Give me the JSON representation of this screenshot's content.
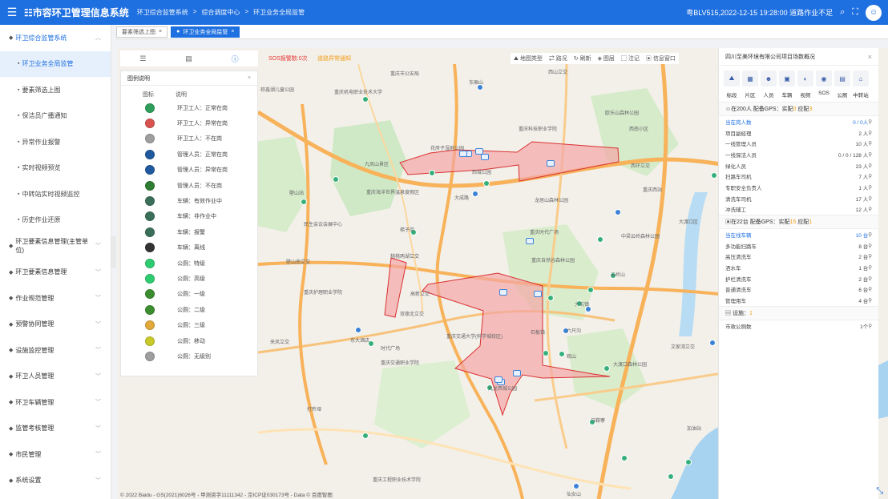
{
  "header": {
    "menu_icon": "menu-icon",
    "logo": "☷市容环卫管理信息系统",
    "crumbs": [
      "环卫综合监管系统",
      ">",
      "综合调度中心",
      ">",
      "环卫业务全局监管"
    ],
    "status": "粤BLV515,2022-12-15 19:28:00 道路作业不足",
    "icons": [
      "search-icon",
      "fullscreen-icon",
      "avatar"
    ]
  },
  "sidebar": {
    "items": [
      {
        "label": "环卫综合监管系统",
        "level": "top",
        "expanded": true
      },
      {
        "label": "环卫业务全局监管",
        "level": "sub",
        "active": true
      },
      {
        "label": "要素筛选上图",
        "level": "sub"
      },
      {
        "label": "保洁员广播通知",
        "level": "sub"
      },
      {
        "label": "异常作业报警",
        "level": "sub"
      },
      {
        "label": "实时视频预览",
        "level": "sub"
      },
      {
        "label": "中转站实时视频监控",
        "level": "sub"
      },
      {
        "label": "历史作业还原",
        "level": "sub"
      },
      {
        "label": "环卫要素信息管理(主管单位)",
        "level": "top"
      },
      {
        "label": "环卫要素信息管理",
        "level": "top"
      },
      {
        "label": "作业规范管理",
        "level": "top"
      },
      {
        "label": "预警协同管理",
        "level": "top"
      },
      {
        "label": "设施监控管理",
        "level": "top"
      },
      {
        "label": "环卫人员管理",
        "level": "top"
      },
      {
        "label": "环卫车辆管理",
        "level": "top"
      },
      {
        "label": "监管考核管理",
        "level": "top"
      },
      {
        "label": "市民管理",
        "level": "top"
      },
      {
        "label": "系统设置",
        "level": "top"
      },
      {
        "label": "设备管理",
        "level": "top"
      }
    ]
  },
  "tabs": [
    {
      "label": "要素筛选上图",
      "active": false
    },
    {
      "label": "环卫业务全局监管",
      "active": true
    }
  ],
  "map": {
    "sos": "SOS报警数:0次",
    "alarm": "道路异常通知",
    "tools": [
      "地图类型",
      "路况",
      "刷新",
      "图层",
      "注记",
      "信息窗口"
    ],
    "legend": {
      "title": "图例说明",
      "col1": "图标",
      "col2": "说明",
      "items": [
        {
          "label": "环卫工人：正常在岗",
          "color": "#2e9e5b"
        },
        {
          "label": "环卫工人：异常在岗",
          "color": "#d9534f"
        },
        {
          "label": "环卫工人：不在岗",
          "color": "#9e9e9e"
        },
        {
          "label": "管理人员：正常在岗",
          "color": "#1f5a9e"
        },
        {
          "label": "管理人员：异常在岗",
          "color": "#1f5a9e"
        },
        {
          "label": "管理人员：不在岗",
          "color": "#2e7d32"
        },
        {
          "label": "车辆：有效作业中",
          "color": "#3a6f5a"
        },
        {
          "label": "车辆：非作业中",
          "color": "#3a6f5a"
        },
        {
          "label": "车辆：报警",
          "color": "#3a6f5a"
        },
        {
          "label": "车辆：离线",
          "color": "#333333"
        },
        {
          "label": "公厕：特级",
          "color": "#2ecc71"
        },
        {
          "label": "公厕：高级",
          "color": "#2ecc71"
        },
        {
          "label": "公厕：一级",
          "color": "#3c8d2f"
        },
        {
          "label": "公厕：二级",
          "color": "#3c8d2f"
        },
        {
          "label": "公厕：三级",
          "color": "#e0a93a"
        },
        {
          "label": "公厕：移动",
          "color": "#c9c92a"
        },
        {
          "label": "公厕：无级别",
          "color": "#9e9e9e"
        }
      ]
    },
    "copyright": "© 2022 Baidu - GS(2021)6026号 - 甲测资字11111342 - 京ICP证030173号 - Data © 百度智图",
    "places": [
      {
        "name": "重庆市公安局",
        "pos": [
          340,
          27
        ]
      },
      {
        "name": "棕鑫湖儿童公园",
        "pos": [
          178,
          47
        ]
      },
      {
        "name": "重庆机电职业技术大学",
        "pos": [
          270,
          50
        ]
      },
      {
        "name": "西山立交",
        "pos": [
          537,
          25
        ]
      },
      {
        "name": "东厢山",
        "pos": [
          438,
          38
        ]
      },
      {
        "name": "欧乐山森林公园",
        "pos": [
          608,
          76
        ]
      },
      {
        "name": "西南小区",
        "pos": [
          638,
          96
        ]
      },
      {
        "name": "重庆科技职业学院",
        "pos": [
          500,
          96
        ]
      },
      {
        "name": "花房子湿地公园",
        "pos": [
          390,
          120
        ]
      },
      {
        "name": "九凤山景区",
        "pos": [
          308,
          140
        ]
      },
      {
        "name": "西城公园",
        "pos": [
          442,
          150
        ]
      },
      {
        "name": "西环立交",
        "pos": [
          640,
          142
        ]
      },
      {
        "name": "重庆海洋世界温泉度假区",
        "pos": [
          310,
          175
        ]
      },
      {
        "name": "大成路",
        "pos": [
          420,
          182
        ]
      },
      {
        "name": "龙居山森林公园",
        "pos": [
          520,
          185
        ]
      },
      {
        "name": "重庆西站",
        "pos": [
          655,
          172
        ]
      },
      {
        "name": "大渡口区",
        "pos": [
          700,
          212
        ]
      },
      {
        "name": "民生会议会展中心",
        "pos": [
          232,
          215
        ]
      },
      {
        "name": "壁山站",
        "pos": [
          214,
          176
        ]
      },
      {
        "name": "梯子岗",
        "pos": [
          352,
          222
        ]
      },
      {
        "name": "重庆时代广场",
        "pos": [
          514,
          225
        ]
      },
      {
        "name": "中梁云岭森林公园",
        "pos": [
          628,
          230
        ]
      },
      {
        "name": "壁山南立交",
        "pos": [
          210,
          262
        ]
      },
      {
        "name": "桃桃两湖立交",
        "pos": [
          340,
          255
        ]
      },
      {
        "name": "重庆自然谷森林公园",
        "pos": [
          516,
          260
        ]
      },
      {
        "name": "云岭山",
        "pos": [
          615,
          278
        ]
      },
      {
        "name": "重庆护理职业学院",
        "pos": [
          232,
          300
        ]
      },
      {
        "name": "高新立交",
        "pos": [
          365,
          302
        ]
      },
      {
        "name": "双德北立交",
        "pos": [
          352,
          327
        ]
      },
      {
        "name": "大坑镇",
        "pos": [
          570,
          315
        ]
      },
      {
        "name": "六尺沟",
        "pos": [
          560,
          348
        ]
      },
      {
        "name": "重庆交通大学(科学城校区)",
        "pos": [
          410,
          355
        ]
      },
      {
        "name": "来凤立交",
        "pos": [
          190,
          362
        ]
      },
      {
        "name": "东大酒店",
        "pos": [
          290,
          360
        ]
      },
      {
        "name": "时代广场",
        "pos": [
          328,
          370
        ]
      },
      {
        "name": "观山",
        "pos": [
          560,
          380
        ]
      },
      {
        "name": "重庆交通职业学院",
        "pos": [
          328,
          388
        ]
      },
      {
        "name": "大渡口森林公园",
        "pos": [
          618,
          390
        ]
      },
      {
        "name": "文家湾立交",
        "pos": [
          690,
          368
        ]
      },
      {
        "name": "九龙西城公园",
        "pos": [
          462,
          420
        ]
      },
      {
        "name": "打杵垭",
        "pos": [
          236,
          446
        ]
      },
      {
        "name": "马鞍寨",
        "pos": [
          590,
          460
        ]
      },
      {
        "name": "重庆工程职业技术学院",
        "pos": [
          318,
          534
        ]
      },
      {
        "name": "加油站",
        "pos": [
          710,
          470
        ]
      },
      {
        "name": "仙女山",
        "pos": [
          560,
          552
        ]
      },
      {
        "name": "石板镇",
        "pos": [
          515,
          350
        ]
      }
    ],
    "poi_positions": [
      [
        448,
        45
      ],
      [
        305,
        60
      ],
      [
        388,
        152
      ],
      [
        228,
        188
      ],
      [
        442,
        178
      ],
      [
        456,
        165
      ],
      [
        268,
        160
      ],
      [
        365,
        226
      ],
      [
        620,
        201
      ],
      [
        598,
        235
      ],
      [
        536,
        308
      ],
      [
        614,
        280
      ],
      [
        555,
        349
      ],
      [
        550,
        378
      ],
      [
        530,
        377
      ],
      [
        586,
        298
      ],
      [
        583,
        322
      ],
      [
        572,
        315
      ],
      [
        606,
        396
      ],
      [
        588,
        463
      ],
      [
        296,
        348
      ],
      [
        312,
        365
      ],
      [
        305,
        480
      ],
      [
        740,
        155
      ],
      [
        738,
        364
      ],
      [
        708,
        513
      ],
      [
        686,
        531
      ],
      [
        628,
        508
      ],
      [
        568,
        543
      ],
      [
        460,
        420
      ]
    ],
    "vehicle_positions": [
      [
        432,
        128
      ],
      [
        446,
        125
      ],
      [
        535,
        140
      ],
      [
        509,
        237
      ],
      [
        476,
        301
      ],
      [
        519,
        303
      ],
      [
        473,
        413
      ],
      [
        493,
        402
      ],
      [
        470,
        410
      ],
      [
        426,
        128
      ],
      [
        453,
        132
      ]
    ]
  },
  "info": {
    "title": "四川至美环境有限公司项目场数概况",
    "icon_tabs": [
      "标段",
      "片区",
      "人员",
      "车辆",
      "视频",
      "SOS",
      "公厕",
      "中转站"
    ],
    "icon_glyphs": [
      "⛰",
      "▦",
      "☻",
      "▣",
      "◐",
      "◉",
      "▤",
      "⌂"
    ],
    "people_header": {
      "text": "在200人 配备GPS：实配",
      "a": "0",
      "b": " 应配",
      "c": "3"
    },
    "people": [
      {
        "label": "当在岗人数",
        "value": "0 / 0人",
        "blue": true
      },
      {
        "label": "项目副经理",
        "value": "2 人"
      },
      {
        "label": "一线管理人员",
        "value": "10 人"
      },
      {
        "label": "一线保洁人员",
        "value": "0 / 0 / 128 人"
      },
      {
        "label": "绿化人员",
        "value": "23 人"
      },
      {
        "label": "扫路车司机",
        "value": "7 人"
      },
      {
        "label": "专职安全负责人",
        "value": "1 人"
      },
      {
        "label": "清洗车司机",
        "value": "17 人"
      },
      {
        "label": "冲洗辅工",
        "value": "12 人"
      }
    ],
    "vehicle_header": {
      "text": "在22台 配备GPS：实配",
      "a": "15",
      "b": " 应配",
      "c": "1"
    },
    "vehicles": [
      {
        "label": "当在线车辆",
        "value": "10 台",
        "blue": true
      },
      {
        "label": "多功能扫路车",
        "value": "8 台"
      },
      {
        "label": "高压清洗车",
        "value": "2 台"
      },
      {
        "label": "洒水车",
        "value": "1 台"
      },
      {
        "label": "护栏清洗车",
        "value": "2 台"
      },
      {
        "label": "普通清洗车",
        "value": "6 台"
      },
      {
        "label": "管理用车",
        "value": "4 台"
      }
    ],
    "facility_header": {
      "text": "设施：",
      "a": "1"
    },
    "facilities": [
      {
        "label": "市政公厕数",
        "value": "1个"
      }
    ]
  },
  "colors": {
    "primary": "#1e6fe0",
    "zone_fill": "#f4a6a6",
    "zone_stroke": "#d93030",
    "road": "#f7b25a",
    "green": "#cfe9c6",
    "water": "#a8d3f0"
  }
}
